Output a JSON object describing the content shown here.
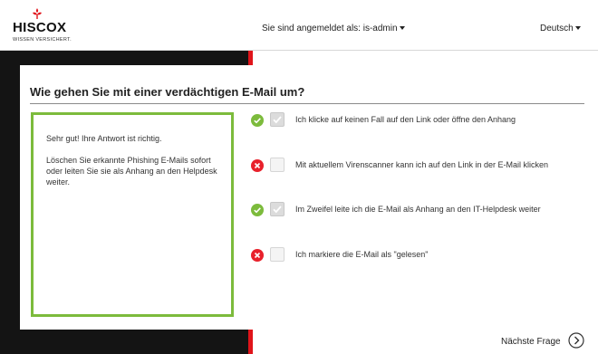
{
  "brand": {
    "name": "HISCOX",
    "tagline": "WISSEN VERSICHERT."
  },
  "header": {
    "user_label": "Sie sind angemeldet als: is-admin",
    "language": "Deutsch"
  },
  "colors": {
    "brand_red": "#e0141a",
    "correct_green": "#7cbb3c",
    "wrong_red": "#e8212b"
  },
  "quiz": {
    "question": "Wie gehen Sie mit einer verdächtigen E-Mail um?",
    "feedback": {
      "result": "Sehr gut! Ihre Antwort ist richtig.",
      "explanation": "Löschen Sie erkannte Phishing E-Mails sofort oder leiten Sie sie als Anhang an den Helpdesk weiter."
    },
    "answers": [
      {
        "text": "Ich klicke auf keinen Fall auf den Link oder öffne den Anhang",
        "status": "correct",
        "checked": true,
        "status_icon": "check-circle-icon"
      },
      {
        "text": "Mit aktuellem Virenscanner kann ich auf den Link in der E-Mail klicken",
        "status": "wrong",
        "checked": false,
        "status_icon": "x-circle-icon"
      },
      {
        "text": "Im Zweifel leite ich die E-Mail als Anhang an den IT-Helpdesk weiter",
        "status": "correct",
        "checked": true,
        "status_icon": "check-circle-icon"
      },
      {
        "text": "Ich markiere die E-Mail als \"gelesen\"",
        "status": "wrong",
        "checked": false,
        "status_icon": "x-circle-icon"
      }
    ],
    "next_label": "Nächste Frage"
  }
}
